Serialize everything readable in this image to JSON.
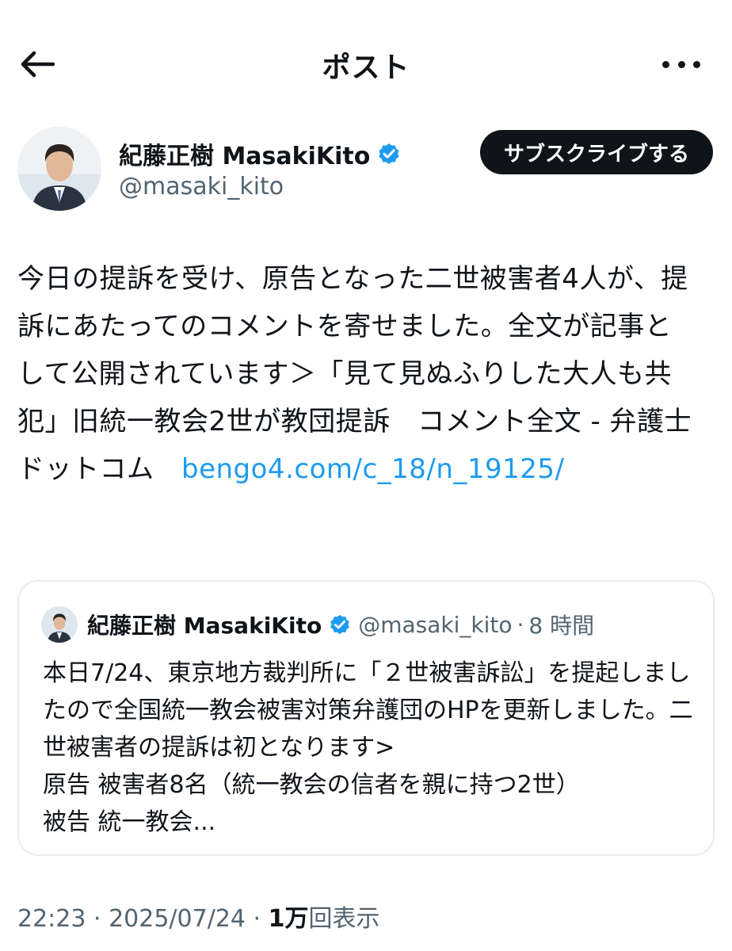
{
  "header": {
    "title": "ポスト"
  },
  "icons": {
    "back": "arrow-left-icon",
    "more": "more-horizontal-icon",
    "verified": "verified-badge-icon"
  },
  "colors": {
    "link": "#1d9bf0",
    "verified": "#1d9bf0",
    "button_bg": "#0f1419",
    "secondary_text": "#536471"
  },
  "author": {
    "name": "紀藤正樹 MasakiKito",
    "handle": "@masaki_kito",
    "subscribe_label": "サブスクライブする"
  },
  "post": {
    "text": "今日の提訴を受け、原告となった二世被害者4人が、提訴にあたってのコメントを寄せました。全文が記事として公開されています＞「見て見ぬふりした大人も共犯」旧統一教会2世が教団提訴　コメント全文 - 弁護士ドットコム　",
    "link": "bengo4.com/c_18/n_19125/"
  },
  "quote": {
    "name": "紀藤正樹 MasakiKito",
    "handle": "@masaki_kito",
    "separator": "·",
    "time": "8 時間",
    "text": "本日7/24、東京地方裁判所に「２世被害訴訟」を提起しましたので全国統一教会被害対策弁護団のHPを更新しました。二世被害者の提訴は初となります>\n原告 被害者8名（統一教会の信者を親に持つ2世）\n被告 統一教会..."
  },
  "meta": {
    "time": "22:23",
    "sep1": " · ",
    "date": "2025/07/24",
    "sep2": " · ",
    "views_count": "1万",
    "views_label": "回表示"
  }
}
